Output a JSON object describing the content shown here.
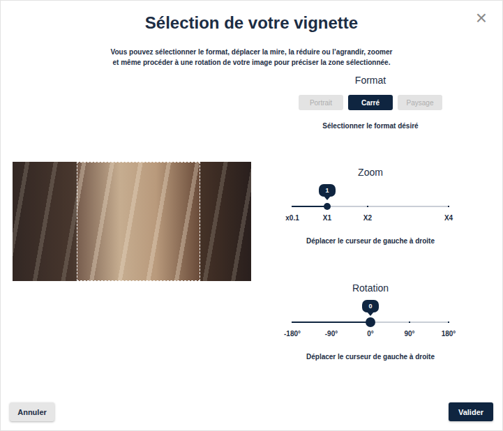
{
  "dialog": {
    "title": "Sélection de votre vignette",
    "close": "×",
    "instructions": [
      "Vous pouvez sélectionner le format, déplacer la mire, la réduire ou l’agrandir, zoomer",
      "et même procéder à une rotation de votre image pour préciser la zone sélectionnée."
    ]
  },
  "format": {
    "title": "Format",
    "options": [
      {
        "label": "Portrait",
        "selected": false
      },
      {
        "label": "Carré",
        "selected": true
      },
      {
        "label": "Paysage",
        "selected": false
      }
    ],
    "hint": "Sélectionner le format désiré"
  },
  "zoom": {
    "title": "Zoom",
    "value": "1",
    "level": 0.223,
    "ticks": [
      "x0.1",
      "X1",
      "X2",
      "X4"
    ],
    "hint": "Déplacer le curseur de gauche à droite"
  },
  "rotation": {
    "title": "Rotation",
    "value": "0",
    "level": 0.5,
    "ticks": [
      "-180°",
      "-90°",
      "0°",
      "90°",
      "180°"
    ],
    "hint": "Déplacer le curseur de gauche à droite"
  },
  "buttons": [
    {
      "label": "Annuler",
      "kind": "secondary"
    },
    {
      "label": "Valider",
      "kind": "primary"
    }
  ]
}
